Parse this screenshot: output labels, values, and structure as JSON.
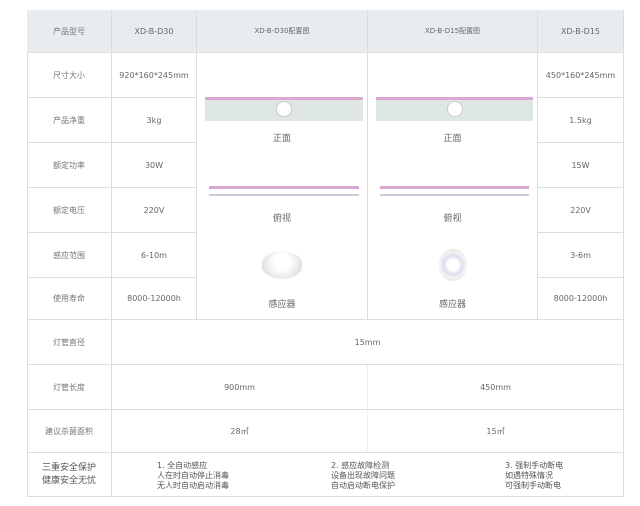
{
  "header": {
    "label": "产品型号",
    "m1": "XD-B-D30",
    "img1": "XD-B-D30配置图",
    "img2": "XD-B-D15配置图",
    "m2": "XD-B-D15"
  },
  "rows": [
    {
      "label": "尺寸大小",
      "d30": "920*160*245mm",
      "d15": "450*160*245mm"
    },
    {
      "label": "产品净重",
      "d30": "3kg",
      "d15": "1.5kg"
    },
    {
      "label": "额定功率",
      "d30": "30W",
      "d15": "15W"
    },
    {
      "label": "额定电压",
      "d30": "220V",
      "d15": "220V"
    },
    {
      "label": "感应范围",
      "d30": "6-10m",
      "d15": "3-6m"
    },
    {
      "label": "使用寿命",
      "d30": "8000-12000h",
      "d15": "8000-12000h"
    }
  ],
  "captions": {
    "front": "正面",
    "top": "俯视",
    "sensor": "感应器"
  },
  "tube_diameter": {
    "label": "灯管直径",
    "value": "15mm"
  },
  "tube_length": {
    "label": "灯管长度",
    "d30": "900mm",
    "d15": "450mm"
  },
  "area": {
    "label": "建议杀菌面积",
    "d30": "28㎡",
    "d15": "15㎡"
  },
  "safety": {
    "label1": "三重安全保护",
    "label2": "健康安全无忧",
    "features": [
      {
        "title": "1. 全自动感应",
        "l1": "人在时自动停止消毒",
        "l2": "无人时自动启动消毒"
      },
      {
        "title": "2. 感应故障检测",
        "l1": "设备出现故障问题",
        "l2": "自动启动断电保护"
      },
      {
        "title": "3. 强制手动断电",
        "l1": "如遇特殊情况",
        "l2": "可强制手动断电"
      }
    ]
  }
}
